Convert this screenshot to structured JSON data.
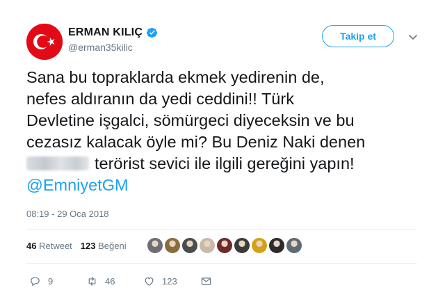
{
  "user": {
    "display_name": "ERMAN KILIÇ",
    "handle": "@erman35kilic",
    "verified": true,
    "avatar_icon": "turkish-flag-icon"
  },
  "follow_button": {
    "label": "Takip et"
  },
  "tweet": {
    "lines": [
      "Sana bu topraklarda ekmek yedirenin de,",
      "nefes aldıranın da yedi ceddini!! Türk",
      "Devletine işgalci, sömürgeci diyeceksin ve bu",
      "cezasız kalacak öyle mi? Bu Deniz Naki denen",
      "terörist sevici ile ilgili gereğini yapın!"
    ],
    "mention": "@EmniyetGM"
  },
  "timestamp": "08:19 - 29 Oca 2018",
  "stats": {
    "retweets_count": "46",
    "retweets_label": "Retweet",
    "likes_count": "123",
    "likes_label": "Beğeni"
  },
  "likers": [
    "#6b6f73",
    "#8a6b3e",
    "#4a4d50",
    "#c9b9a8",
    "#6d2a2a",
    "#3a3a3a",
    "#d4a017",
    "#2b2b2b",
    "#5e6a74"
  ],
  "actions": {
    "reply_count": "9",
    "retweet_count": "46",
    "like_count": "123"
  },
  "colors": {
    "accent": "#1da1f2",
    "flag_red": "#e30a17",
    "muted": "#657786"
  }
}
